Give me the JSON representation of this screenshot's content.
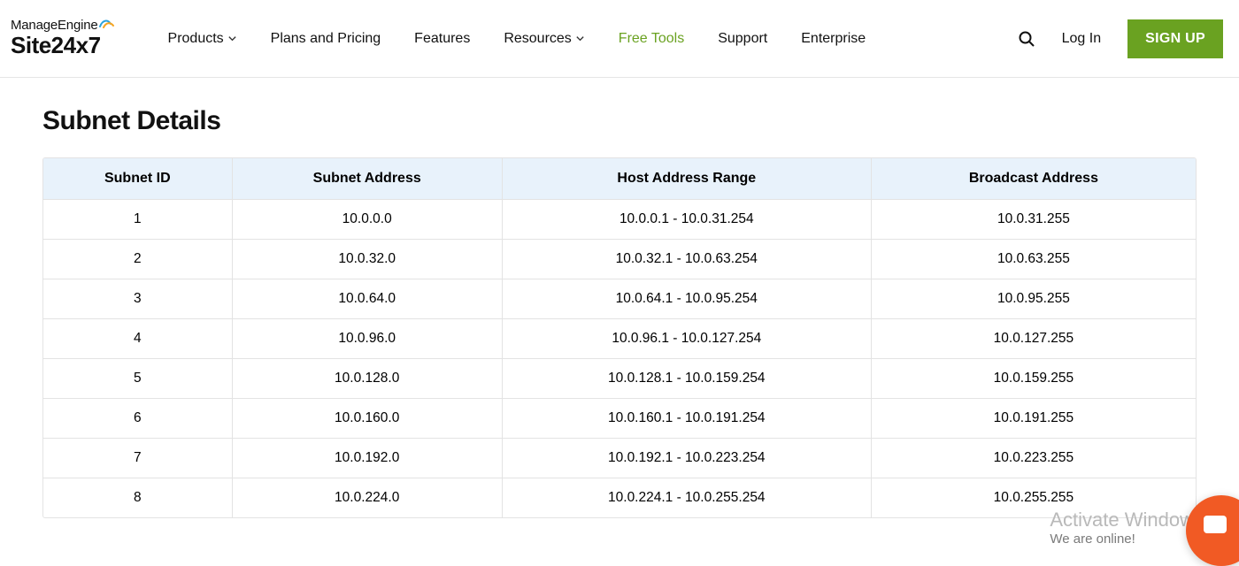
{
  "brand": {
    "parent": "ManageEngine",
    "product": "Site24x7"
  },
  "nav": {
    "products": "Products",
    "plans": "Plans and Pricing",
    "features": "Features",
    "resources": "Resources",
    "freetools": "Free Tools",
    "support": "Support",
    "enterprise": "Enterprise"
  },
  "header": {
    "login": "Log In",
    "signup": "SIGN UP"
  },
  "page": {
    "title": "Subnet Details"
  },
  "table": {
    "headers": {
      "id": "Subnet ID",
      "addr": "Subnet Address",
      "range": "Host Address Range",
      "bcast": "Broadcast Address"
    },
    "rows": [
      {
        "id": "1",
        "addr": "10.0.0.0",
        "range": "10.0.0.1 - 10.0.31.254",
        "bcast": "10.0.31.255"
      },
      {
        "id": "2",
        "addr": "10.0.32.0",
        "range": "10.0.32.1 - 10.0.63.254",
        "bcast": "10.0.63.255"
      },
      {
        "id": "3",
        "addr": "10.0.64.0",
        "range": "10.0.64.1 - 10.0.95.254",
        "bcast": "10.0.95.255"
      },
      {
        "id": "4",
        "addr": "10.0.96.0",
        "range": "10.0.96.1 - 10.0.127.254",
        "bcast": "10.0.127.255"
      },
      {
        "id": "5",
        "addr": "10.0.128.0",
        "range": "10.0.128.1 - 10.0.159.254",
        "bcast": "10.0.159.255"
      },
      {
        "id": "6",
        "addr": "10.0.160.0",
        "range": "10.0.160.1 - 10.0.191.254",
        "bcast": "10.0.191.255"
      },
      {
        "id": "7",
        "addr": "10.0.192.0",
        "range": "10.0.192.1 - 10.0.223.254",
        "bcast": "10.0.223.255"
      },
      {
        "id": "8",
        "addr": "10.0.224.0",
        "range": "10.0.224.1 - 10.0.255.254",
        "bcast": "10.0.255.255"
      }
    ]
  },
  "watermark": {
    "line1": "Activate Windows",
    "line2": "We are online!"
  }
}
